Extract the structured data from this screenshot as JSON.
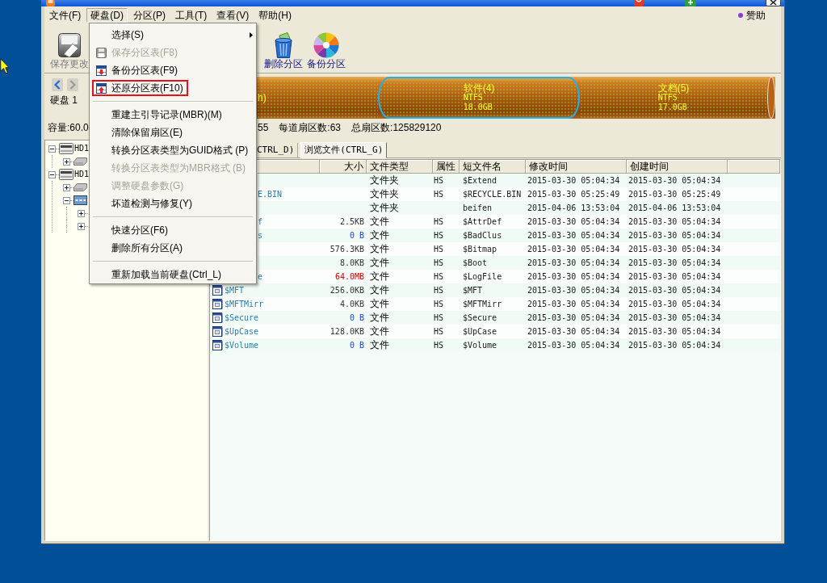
{
  "menu_bar": {
    "items": [
      {
        "label": "文件(F)",
        "selected": false
      },
      {
        "label": "硬盘(D)",
        "selected": true
      },
      {
        "label": "分区(P)",
        "selected": false
      },
      {
        "label": "工具(T)",
        "selected": false
      },
      {
        "label": "查看(V)",
        "selected": false
      },
      {
        "label": "帮助(H)",
        "selected": false
      }
    ],
    "sponsor": "赞助"
  },
  "toolbar": {
    "buttons": [
      {
        "label": "保存更改",
        "disabled": true
      },
      {
        "label": "删除分区",
        "disabled": false
      },
      {
        "label": "备份分区",
        "disabled": false
      }
    ]
  },
  "disk_panel": {
    "nav_buttons": [
      {
        "disabled": false
      },
      {
        "disabled": true
      }
    ],
    "disk_label": "硬盘 1",
    "capacity": "容量:60.0",
    "partitions": [
      {
        "lines": [
          "h)"
        ],
        "selected": false
      },
      {
        "lines": [
          "软件(4)",
          "NTFS",
          "18.0GB"
        ],
        "selected": true
      },
      {
        "lines": [
          "文档(5)",
          "NTFS",
          "17.0GB"
        ],
        "selected": false
      }
    ],
    "geometry": [
      "55",
      "每道扇区数:63",
      "总扇区数:125829120"
    ]
  },
  "tree": {
    "nodes": [
      {
        "kind": "disk",
        "label": "HD1",
        "expanded": true,
        "children": [
          {
            "kind": "partition",
            "expanded": false
          }
        ]
      },
      {
        "kind": "disk",
        "label": "HD1",
        "expanded": true,
        "children": [
          {
            "kind": "partition",
            "expanded": false
          },
          {
            "kind": "extended",
            "expanded": true,
            "children": [
              {
                "expanded": false
              },
              {
                "expanded": false
              }
            ]
          }
        ]
      }
    ]
  },
  "tabs": [
    {
      "label": "CTRL_D)",
      "selected": false
    },
    {
      "label": "浏览文件(CTRL_G)",
      "selected": true
    }
  ],
  "file_list": {
    "columns": [
      "大小",
      "文件类型",
      "属性",
      "短文件名",
      "修改时间",
      "创建时间"
    ],
    "rows": [
      {
        "kind": "covered",
        "type": "文件夹",
        "attr": "HS",
        "short_name": "$Extend",
        "modified": "2015-03-30 05:04:34",
        "created": "2015-03-30 05:04:34"
      },
      {
        "kind": "covered",
        "name": "E.BIN",
        "type": "文件夹",
        "attr": "HS",
        "short_name": "$RECYCLE.BIN",
        "modified": "2015-03-30 05:25:49",
        "created": "2015-03-30 05:25:49"
      },
      {
        "kind": "covered",
        "type": "文件夹",
        "short_name": "beifen",
        "modified": "2015-04-06 13:53:04",
        "created": "2015-04-06 13:53:04"
      },
      {
        "kind": "covered",
        "name": "f",
        "size": {
          "text": "2.5KB",
          "color": "#333333"
        },
        "type": "文件",
        "attr": "HS",
        "short_name": "$AttrDef",
        "modified": "2015-03-30 05:04:34",
        "created": "2015-03-30 05:04:34"
      },
      {
        "kind": "covered",
        "name": "s",
        "size": {
          "text": "0 B",
          "color": "#1c3fd0"
        },
        "type": "文件",
        "attr": "HS",
        "short_name": "$BadClus",
        "modified": "2015-03-30 05:04:34",
        "created": "2015-03-30 05:04:34"
      },
      {
        "kind": "covered",
        "size": {
          "text": "576.3KB",
          "color": "#333333"
        },
        "type": "文件",
        "attr": "HS",
        "short_name": "$Bitmap",
        "modified": "2015-03-30 05:04:34",
        "created": "2015-03-30 05:04:34"
      },
      {
        "kind": "covered",
        "size": {
          "text": "8.0KB",
          "color": "#333333"
        },
        "type": "文件",
        "attr": "HS",
        "short_name": "$Boot",
        "modified": "2015-03-30 05:04:34",
        "created": "2015-03-30 05:04:34"
      },
      {
        "kind": "covered",
        "name": "e",
        "size": {
          "text": "64.0MB",
          "color": "#cc0000"
        },
        "type": "文件",
        "attr": "HS",
        "short_name": "$LogFile",
        "modified": "2015-03-30 05:04:34",
        "created": "2015-03-30 05:04:34"
      },
      {
        "kind": "file",
        "name": "$MFT",
        "size": {
          "text": "256.0KB",
          "color": "#333333"
        },
        "type": "文件",
        "attr": "HS",
        "short_name": "$MFT",
        "modified": "2015-03-30 05:04:34",
        "created": "2015-03-30 05:04:34"
      },
      {
        "kind": "file",
        "name": "$MFTMirr",
        "size": {
          "text": "4.0KB",
          "color": "#333333"
        },
        "type": "文件",
        "attr": "HS",
        "short_name": "$MFTMirr",
        "modified": "2015-03-30 05:04:34",
        "created": "2015-03-30 05:04:34"
      },
      {
        "kind": "file",
        "name": "$Secure",
        "size": {
          "text": "0 B",
          "color": "#1c3fd0"
        },
        "type": "文件",
        "attr": "HS",
        "short_name": "$Secure",
        "modified": "2015-03-30 05:04:34",
        "created": "2015-03-30 05:04:34"
      },
      {
        "kind": "file",
        "name": "$UpCase",
        "size": {
          "text": "128.0KB",
          "color": "#333333"
        },
        "type": "文件",
        "attr": "HS",
        "short_name": "$UpCase",
        "modified": "2015-03-30 05:04:34",
        "created": "2015-03-30 05:04:34"
      },
      {
        "kind": "file",
        "name": "$Volume",
        "size": {
          "text": "0 B",
          "color": "#1c3fd0"
        },
        "type": "文件",
        "attr": "HS",
        "short_name": "$Volume",
        "modified": "2015-03-30 05:04:34",
        "created": "2015-03-30 05:04:34"
      }
    ]
  },
  "disk_menu": {
    "items": [
      {
        "kind": "item",
        "label": "选择(S)",
        "submenu": true,
        "disabled": false,
        "marked": false
      },
      {
        "kind": "icon-item",
        "label": "保存分区表(F8)",
        "submenu": false,
        "disabled": true,
        "marked": false
      },
      {
        "kind": "icon-item",
        "label": "备份分区表(F9)",
        "submenu": false,
        "disabled": false,
        "marked": false
      },
      {
        "kind": "icon-item",
        "label": "还原分区表(F10)",
        "submenu": false,
        "disabled": false,
        "marked": true
      },
      {
        "kind": "separator"
      },
      {
        "kind": "item",
        "label": "重建主引导记录(MBR)(M)",
        "submenu": false,
        "disabled": false,
        "marked": false
      },
      {
        "kind": "item",
        "label": "清除保留扇区(E)",
        "submenu": false,
        "disabled": false,
        "marked": false
      },
      {
        "kind": "item",
        "label": "转换分区表类型为GUID格式 (P)",
        "submenu": false,
        "disabled": false,
        "marked": false
      },
      {
        "kind": "item",
        "label": "转换分区表类型为MBR格式 (B)",
        "submenu": false,
        "disabled": true,
        "marked": false
      },
      {
        "kind": "item",
        "label": "调整硬盘参数(G)",
        "submenu": false,
        "disabled": true,
        "marked": false
      },
      {
        "kind": "item",
        "label": "坏道检测与修复(Y)",
        "submenu": false,
        "disabled": false,
        "marked": false
      },
      {
        "kind": "separator"
      },
      {
        "kind": "item",
        "label": "快速分区(F6)",
        "submenu": false,
        "disabled": false,
        "marked": false
      },
      {
        "kind": "item",
        "label": "删除所有分区(A)",
        "submenu": false,
        "disabled": false,
        "marked": false
      },
      {
        "kind": "separator"
      },
      {
        "kind": "item",
        "label": "重新加载当前硬盘(Ctrl_L)",
        "submenu": false,
        "disabled": false,
        "marked": false
      }
    ]
  }
}
